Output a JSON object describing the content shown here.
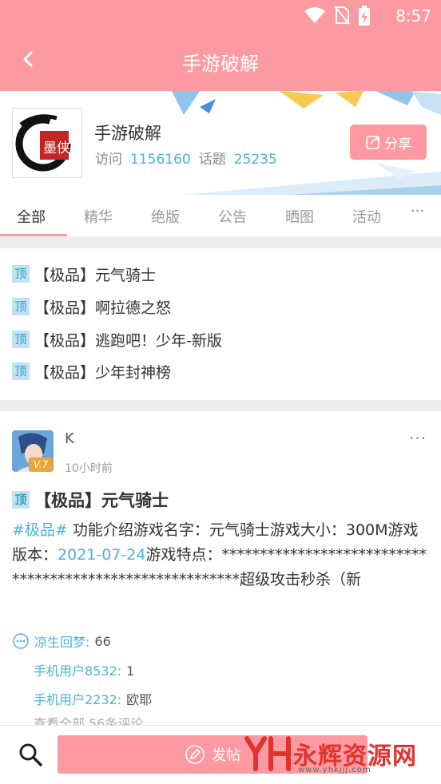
{
  "status_bar": {
    "time": "8:57"
  },
  "titlebar": {
    "title": "手游破解"
  },
  "forum": {
    "name": "手游破解",
    "visits_label": "访问",
    "visits": "1156160",
    "topics_label": "话题",
    "topics": "25235",
    "share_label": "分享",
    "logo_text": "墨侠"
  },
  "tabs": [
    "全部",
    "精华",
    "绝版",
    "公告",
    "晒图",
    "活动"
  ],
  "tabs_more": "···",
  "pin_badge": "顶",
  "pinned": [
    "【极品】元气骑士",
    "【极品】啊拉德之怒",
    "【极品】逃跑吧！少年-新版",
    "【极品】少年封神榜"
  ],
  "post": {
    "username": "K",
    "level": "V.7",
    "time": "10小时前",
    "title": "【极品】元气骑士",
    "tag": "#极品#",
    "body_1": " 功能介绍游戏名字：元气骑士游戏大小：300M游戏版本：",
    "date": "2021-07-24",
    "body_2": "游戏特点：*********************************************************超级攻击秒杀（新",
    "comments": [
      {
        "name": "凉生回梦:",
        "text": "66"
      },
      {
        "name": "手机用户8532:",
        "text": "1"
      },
      {
        "name": "手机用户2232:",
        "text": "欧耶"
      }
    ],
    "view_all": "查看全部 56条评论",
    "more": "···"
  },
  "bottom": {
    "post_label": "发帖"
  },
  "watermark": {
    "text": "永辉资源网",
    "url": "www.yhkjjj.com"
  },
  "colors": {
    "accent": "#fd9aa1",
    "link": "#4ab2da",
    "badge_bg": "#bfe3f3"
  }
}
